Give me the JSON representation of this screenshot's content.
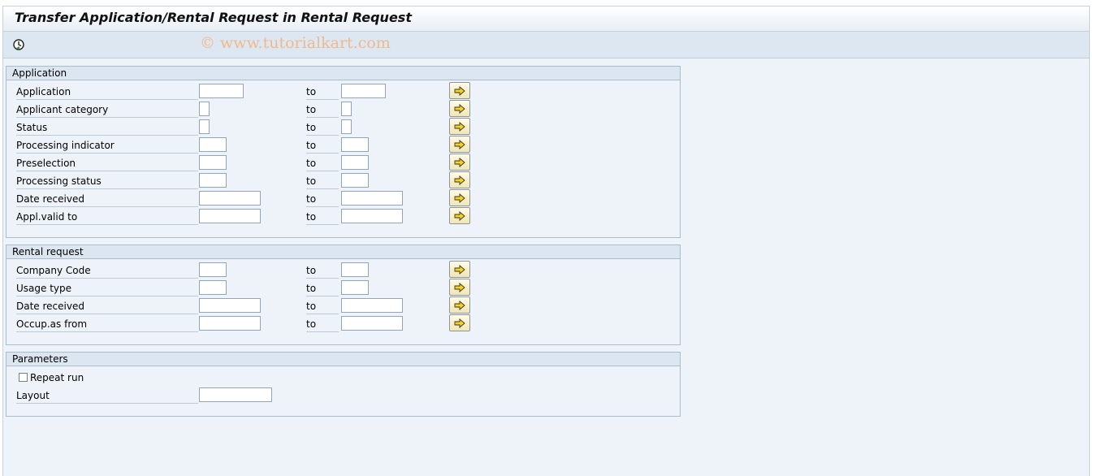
{
  "window": {
    "title": "Transfer Application/Rental Request in Rental Request"
  },
  "toolbar": {
    "execute_icon": "execute-clock-icon",
    "watermark": "© www.tutorialkart.com"
  },
  "common": {
    "to_label": "to",
    "multiple_selection_icon": "arrow-right-icon"
  },
  "application": {
    "header": "Application",
    "rows": [
      {
        "label": "Application",
        "low": "",
        "high": ""
      },
      {
        "label": "Applicant category",
        "low": "",
        "high": ""
      },
      {
        "label": "Status",
        "low": "",
        "high": ""
      },
      {
        "label": "Processing indicator",
        "low": "",
        "high": ""
      },
      {
        "label": "Preselection",
        "low": "",
        "high": ""
      },
      {
        "label": "Processing status",
        "low": "",
        "high": ""
      },
      {
        "label": "Date received",
        "low": "",
        "high": ""
      },
      {
        "label": "Appl.valid to",
        "low": "",
        "high": ""
      }
    ]
  },
  "rental_request": {
    "header": "Rental request",
    "rows": [
      {
        "label": "Company Code",
        "low": "",
        "high": ""
      },
      {
        "label": "Usage type",
        "low": "",
        "high": ""
      },
      {
        "label": "Date received",
        "low": "",
        "high": ""
      },
      {
        "label": "Occup.as from",
        "low": "",
        "high": ""
      }
    ]
  },
  "parameters": {
    "header": "Parameters",
    "repeat_run": {
      "label": "Repeat run",
      "checked": false
    },
    "layout": {
      "label": "Layout",
      "value": ""
    }
  }
}
